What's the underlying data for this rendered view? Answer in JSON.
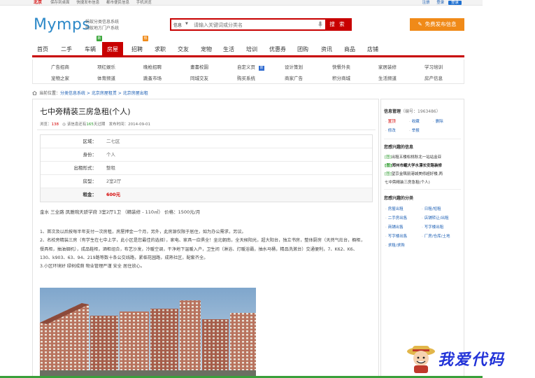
{
  "topbar": {
    "city": "北京",
    "links": [
      "保存到桌面",
      "快捷发布信息",
      "都市便民信息",
      "手机浏览"
    ],
    "register": "注册",
    "login": "登录",
    "login_button": "登录"
  },
  "header": {
    "logo": "Mymps",
    "logo_sub1": "蚂蚁分类信息系统",
    "logo_sub2": "蚂蚁地方门户系统",
    "search_category": "信息",
    "search_placeholder": "请输入关键词或分类名",
    "search_button": "搜 索",
    "post_button": "免费发布信息"
  },
  "nav": {
    "items": [
      "首页",
      "二手",
      "车辆",
      "房屋",
      "招聘",
      "求职",
      "交友",
      "宠物",
      "生活",
      "培训",
      "优惠券",
      "团购",
      "资讯",
      "商品",
      "店铺"
    ],
    "badge_car": "新",
    "badge_job": "热"
  },
  "subnav": {
    "row1": [
      "广告招商",
      "项红娱乐",
      "晚枪招聘",
      "畫書校園",
      "自定义页",
      "设计策划",
      "快餐外卖",
      "家居装修",
      "学习培训"
    ],
    "row2": [
      "宠物之家",
      "体育频道",
      "跳蚤市场",
      "同城交友",
      "购买系统",
      "商家广告",
      "积分商城",
      "生活频道",
      "房产信息"
    ],
    "new_badge": "新"
  },
  "breadcrumb": {
    "prefix": "当前位置：",
    "path": "分类信息系统 > 北京房屋租赁 > 北京房屋出租"
  },
  "post": {
    "title": "七中旁精装三房急租(个人)",
    "views_label": "浏览：",
    "views": "138",
    "valid_prefix": "◎ 该信息还有",
    "valid_days": "165",
    "valid_suffix": "天过期",
    "date": "发布时间：2014-09-01",
    "fields": [
      {
        "k": "区域：",
        "v": "二七区"
      },
      {
        "k": "身份：",
        "v": "个人"
      },
      {
        "k": "出租形式：",
        "v": "整租"
      },
      {
        "k": "房型：",
        "v": "2室2厅"
      },
      {
        "k": "租金：",
        "v": "600元"
      }
    ],
    "summary": "金水  三全路  凤雅琬天骄学府  3室2厅1卫  （精装修 - 110㎡）  价格：1500元/月",
    "desc": [
      "1、首次及以后按每半年支付一次房租，房屋押金一个月，另外，此房源仅限于居住，如为办公需求，另议。",
      "2、名校旁精装三房（有学生在七中上学，此小区是您最佳的选择），家电、家具一应俱全！坐北朝南，全天候阳光，超大阳台，独立书房，整体厨房（天然气灶台，橱柜，餐具柜，抽油烟机），成品鞋柜，酒柜组合，布艺沙发，冷暖空调，干净地下温暖入户，卫生间（淋浴、灯暖浴霸，抽水马桶，精品洗漱台）交通便利，7、K62、K6、130、k903、63、94、219路等数十条公交线路，紧临花园路，成熟社区，配套齐全。",
      "3.小区环境好 绿树成荫 物业管理严谨 安全 居住放心。"
    ]
  },
  "sidebar": {
    "manage_title": "信息管理",
    "manage_id": "（编号：1963486）",
    "actions": [
      "置顶",
      "收藏",
      "删除",
      "修改",
      "举报"
    ],
    "interest_title": "您感兴趣的信息",
    "interest": [
      {
        "tag": "[图]",
        "text": "出租五楼松桃秋北一站站金亚"
      },
      {
        "tag": "[图]",
        "text": "郑州市崛大学水漂长安路装修"
      },
      {
        "tag": "[图]",
        "text": "望京金隅丽港城美修超好楼,两"
      },
      {
        "tag": "",
        "text": "七中旁精装三房急租(个人)"
      }
    ],
    "category_title": "您感兴趣的分类",
    "categories": [
      "房屋出租",
      "日租/短租",
      "二手房出售",
      "店铺转让/出租",
      "商铺出售",
      "写字楼出租",
      "写字楼出售",
      "厂房/仓库/土地",
      "求租/求购"
    ]
  },
  "watermark": "我爱代码"
}
